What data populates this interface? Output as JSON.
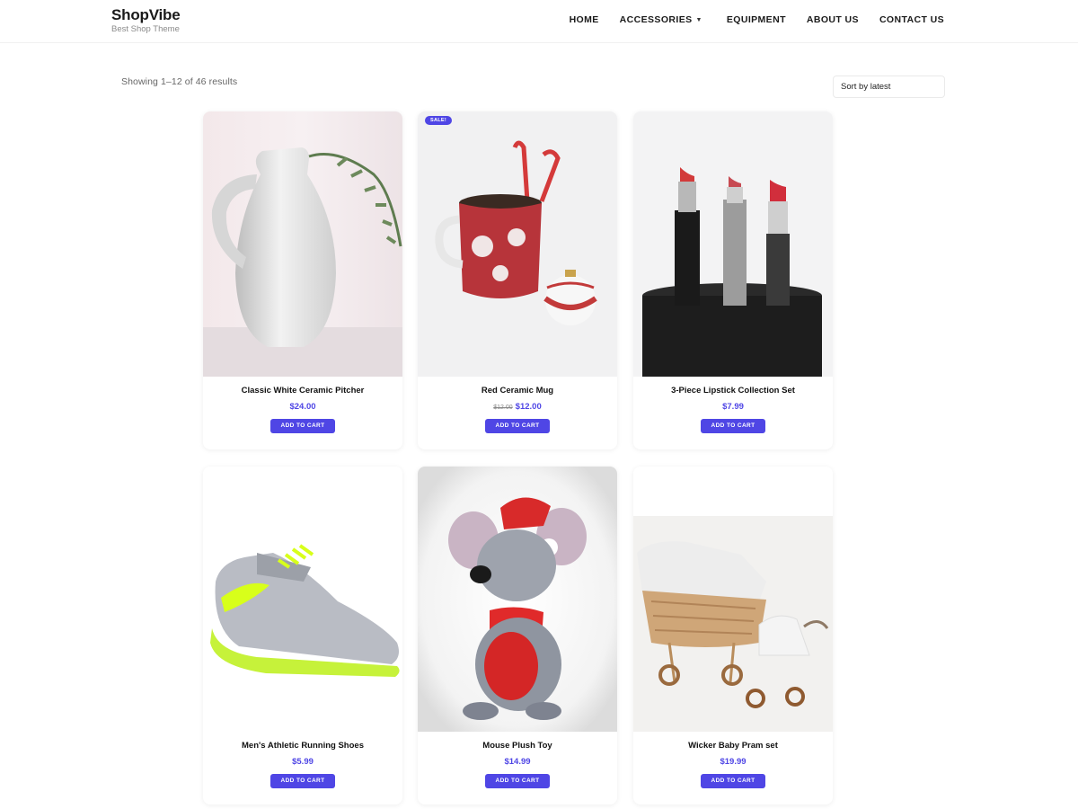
{
  "brand": {
    "title": "ShopVibe",
    "tagline": "Best Shop Theme"
  },
  "nav": {
    "home": "HOME",
    "accessories": "ACCESSORIES",
    "equipment": "EQUIPMENT",
    "about": "ABOUT US",
    "contact": "CONTACT US"
  },
  "toolbar": {
    "result_count": "Showing 1–12 of 46 results",
    "sort_selected": "Sort by latest"
  },
  "products": [
    {
      "title": "Classic White Ceramic Pitcher",
      "price": "$24.00",
      "old_price": "",
      "button": "ADD TO CART",
      "image_icon": "pitcher-image"
    },
    {
      "title": "Red Ceramic Mug",
      "price": "$12.00",
      "old_price": "$12.00",
      "badge": "SALE!",
      "button": "ADD TO CART",
      "image_icon": "mug-image"
    },
    {
      "title": "3-Piece Lipstick Collection Set",
      "price": "$7.99",
      "old_price": "",
      "button": "ADD TO CART",
      "image_icon": "lipstick-image"
    },
    {
      "title": "Men's Athletic Running Shoes",
      "price": "$5.99",
      "old_price": "",
      "button": "ADD TO CART",
      "image_icon": "shoe-image"
    },
    {
      "title": "Mouse Plush Toy",
      "price": "$14.99",
      "old_price": "",
      "button": "ADD TO CART",
      "image_icon": "plush-mouse-image"
    },
    {
      "title": "Wicker Baby Pram set",
      "price": "$19.99",
      "old_price": "",
      "button": "ADD TO CART",
      "image_icon": "pram-image"
    }
  ],
  "colors": {
    "accent": "#4f46e5",
    "text": "#111111",
    "muted": "#666666"
  }
}
